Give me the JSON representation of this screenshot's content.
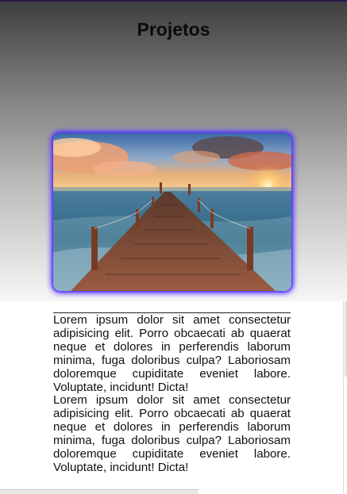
{
  "page": {
    "title": "Projetos"
  },
  "hero_image": {
    "subject": "wooden pier leading into the sea at sunset",
    "glow_color": "#5b3bff"
  },
  "article": {
    "paragraphs": [
      "Lorem ipsum dolor sit amet consectetur adipisicing elit. Porro obcaecati ab quaerat neque et dolores in perferendis laborum minima, fuga doloribus culpa? Laboriosam doloremque cupiditate eveniet labore. Voluptate, incidunt! Dicta!",
      "Lorem ipsum dolor sit amet consectetur adipisicing elit. Porro obcaecati ab quaerat neque et dolores in perferendis laborum minima, fuga doloribus culpa? Laboriosam doloremque cupiditate eveniet labore. Voluptate, incidunt! Dicta!"
    ]
  },
  "colors": {
    "hero_gradient_top": "#3e3e3e",
    "hero_gradient_bottom": "#f6f6f6",
    "text": "#111111"
  }
}
